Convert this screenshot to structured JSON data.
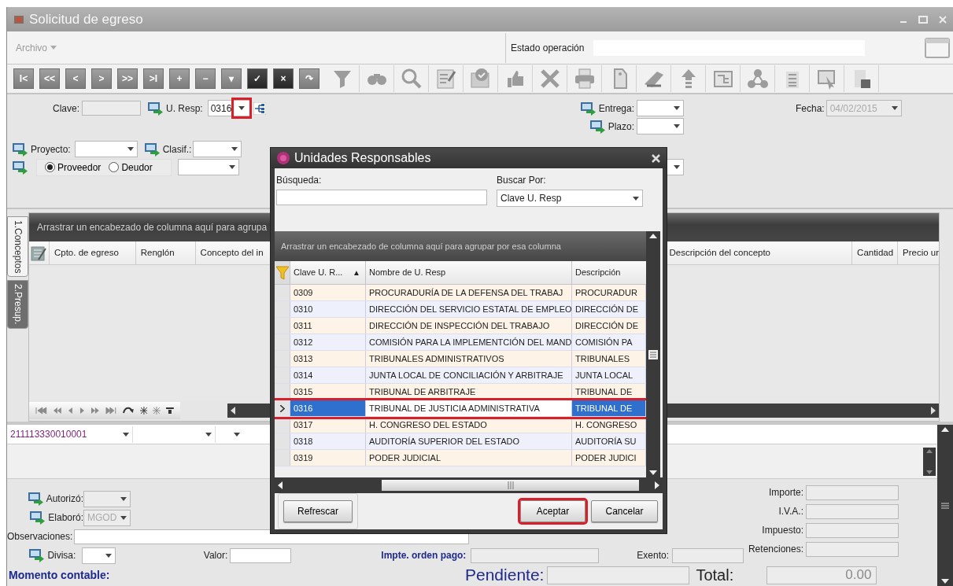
{
  "window": {
    "title": "Solicitud de egreso"
  },
  "menu": {
    "items": [
      {
        "label": "Archivo"
      }
    ]
  },
  "status": {
    "label": "Estado operación"
  },
  "nav_buttons": [
    {
      "symbol": "I<",
      "enabled": false
    },
    {
      "symbol": "<<",
      "enabled": false
    },
    {
      "symbol": "<",
      "enabled": false
    },
    {
      "symbol": ">",
      "enabled": false
    },
    {
      "symbol": ">>",
      "enabled": false
    },
    {
      "symbol": ">I",
      "enabled": false
    },
    {
      "symbol": "+",
      "enabled": false
    },
    {
      "symbol": "−",
      "enabled": false
    },
    {
      "symbol": "▾",
      "enabled": false
    },
    {
      "symbol": "✓",
      "enabled": true
    },
    {
      "symbol": "×",
      "enabled": true
    },
    {
      "symbol": "↷",
      "enabled": false
    }
  ],
  "form": {
    "clave_label": "Clave:",
    "u_resp": {
      "label": "U. Resp:",
      "value": "0316",
      "highlighted": true
    },
    "entrega_label": "Entrega:",
    "plazo_label": "Plazo:",
    "fecha": {
      "label": "Fecha:",
      "value": "04/02/2015",
      "disabled": true
    },
    "proyecto_label": "Proyecto:",
    "clasif_label": "Clasif.:",
    "radios": [
      {
        "label": "Proveedor",
        "selected": true
      },
      {
        "label": "Deudor",
        "selected": false
      }
    ]
  },
  "tabs": [
    {
      "label": "1.Conceptos",
      "selected": true
    },
    {
      "label": "2.Presup.",
      "selected": false
    }
  ],
  "grid": {
    "group_hint": "Arrastrar un encabezado de columna aquí para agrupa",
    "columns_left": [
      "Cpto. de egreso",
      "Renglón",
      "Concepto del in"
    ],
    "columns_right": [
      "Descripción del concepto",
      "Cantidad",
      "Precio ur"
    ]
  },
  "bottom": {
    "account": "211113330010001",
    "autorizo_label": "Autorizó:",
    "elaboro": {
      "label": "Elaboró:",
      "value": "MGOD"
    },
    "observaciones_label": "Observaciones:",
    "divisa_label": "Divisa:",
    "valor_label": "Valor:",
    "impte_label": "Impte. orden pago:",
    "exento_label": "Exento:",
    "momento_label": "Momento contable:",
    "pendiente_label": "Pendiente:",
    "total": {
      "label": "Total:",
      "value": "0.00"
    },
    "totals": [
      "Importe:",
      "I.V.A.:",
      "Impuesto:",
      "Retenciones:"
    ]
  },
  "dialog": {
    "title": "Unidades Responsables",
    "search_label": "Búsqueda:",
    "search_by_label": "Buscar Por:",
    "search_by_value": "Clave U. Resp",
    "group_hint": "Arrastrar un encabezado de columna aquí para agrupar por esa columna",
    "columns": [
      "Clave U. R...",
      "Nombre de U. Resp",
      "Descripción"
    ],
    "sort_mark": "▲",
    "rows": [
      {
        "clave": "0309",
        "nombre": "PROCURADURÍA DE LA DEFENSA DEL TRABAJ",
        "descripcion": "PROCURADUR",
        "selected": false,
        "highlighted": false
      },
      {
        "clave": "0310",
        "nombre": "DIRECCIÓN DEL SERVICIO ESTATAL DE EMPLEO",
        "descripcion": "DIRECCIÓN DE",
        "selected": false,
        "highlighted": false
      },
      {
        "clave": "0311",
        "nombre": "DIRECCIÓN DE INSPECCIÓN DEL TRABAJO",
        "descripcion": "DIRECCIÓN DE",
        "selected": false,
        "highlighted": false
      },
      {
        "clave": "0312",
        "nombre": "COMISIÓN PARA LA IMPLEMENTCIÓN DEL MAND",
        "descripcion": "COMISIÓN PA",
        "selected": false,
        "highlighted": false
      },
      {
        "clave": "0313",
        "nombre": "TRIBUNALES ADMINISTRATIVOS",
        "descripcion": "TRIBUNALES",
        "selected": false,
        "highlighted": false
      },
      {
        "clave": "0314",
        "nombre": "JUNTA LOCAL DE CONCILIACIÓN Y ARBITRAJE",
        "descripcion": "JUNTA LOCAL",
        "selected": false,
        "highlighted": false
      },
      {
        "clave": "0315",
        "nombre": "TRIBUNAL DE ARBITRAJE",
        "descripcion": "TRIBUNAL DE",
        "selected": false,
        "highlighted": false
      },
      {
        "clave": "0316",
        "nombre": "TRIBUNAL DE JUSTICIA ADMINISTRATIVA",
        "descripcion": "TRIBUNAL DE",
        "selected": true,
        "highlighted": true
      },
      {
        "clave": "0317",
        "nombre": "H. CONGRESO DEL ESTADO",
        "descripcion": "H. CONGRESO",
        "selected": false,
        "highlighted": false
      },
      {
        "clave": "0318",
        "nombre": "AUDITORÍA SUPERIOR DEL ESTADO",
        "descripcion": "AUDITORÍA SU",
        "selected": false,
        "highlighted": false
      },
      {
        "clave": "0319",
        "nombre": "PODER JUDICIAL",
        "descripcion": "PODER JUDICI",
        "selected": false,
        "highlighted": false
      }
    ],
    "buttons": [
      {
        "label": "Refrescar",
        "highlighted": false
      },
      {
        "label": "Aceptar",
        "highlighted": true
      },
      {
        "label": "Cancelar",
        "highlighted": false
      }
    ]
  }
}
